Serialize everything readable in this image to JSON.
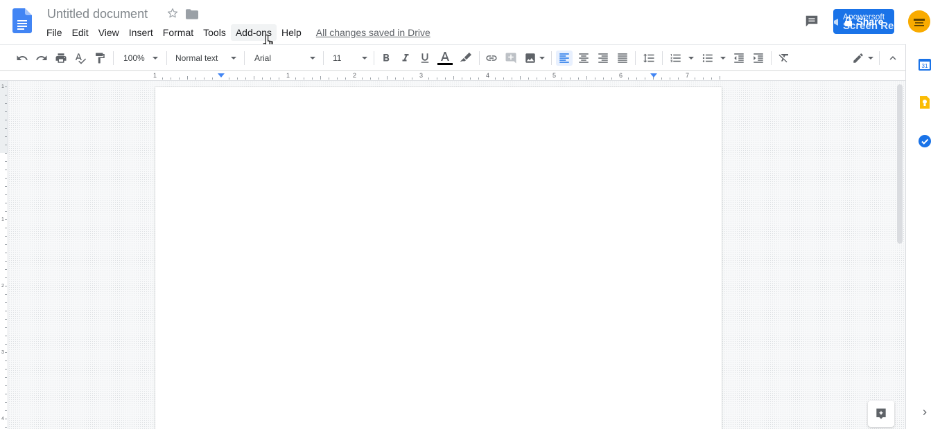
{
  "header": {
    "title": "Untitled document",
    "saved_status": "All changes saved in Drive",
    "share_label": "Share",
    "watermark_line1": "Apowersoft",
    "watermark_line2": "Screen Recorder"
  },
  "menu": [
    "File",
    "Edit",
    "View",
    "Insert",
    "Format",
    "Tools",
    "Add-ons",
    "Help"
  ],
  "toolbar": {
    "zoom": "100%",
    "style": "Normal text",
    "font": "Arial",
    "size": "11"
  },
  "ruler": {
    "labels": [
      "1",
      "1",
      "2",
      "3",
      "4",
      "5",
      "6",
      "7"
    ]
  },
  "vruler": {
    "labels": [
      "1",
      "1",
      "2",
      "3",
      "4"
    ]
  },
  "colors": {
    "accent": "#1a73e8",
    "docs_blue": "#4285f4",
    "text_color_bar": "#000000",
    "avatar": "#f9ab00",
    "keep_yellow": "#fbbc04"
  },
  "icons": {
    "side_panel": [
      "calendar-icon",
      "keep-icon",
      "tasks-icon"
    ]
  }
}
